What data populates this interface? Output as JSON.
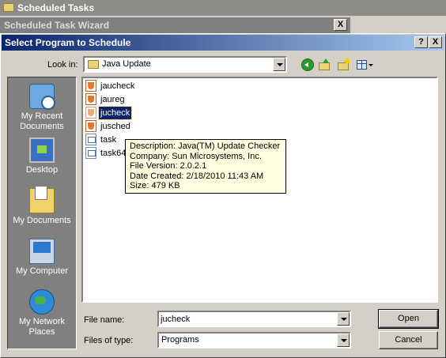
{
  "background_window": {
    "title": "Scheduled Tasks"
  },
  "wizard_window": {
    "title": "Scheduled Task Wizard",
    "close_label": "X"
  },
  "dialog": {
    "title": "Select Program to Schedule",
    "help_label": "?",
    "close_label": "X"
  },
  "lookin": {
    "label": "Look in:",
    "value": "Java Update"
  },
  "toolbar": {
    "back_icon": "back-arrow-icon",
    "up_icon": "up-one-level-icon",
    "newfolder_icon": "new-folder-icon",
    "views_icon": "views-menu-icon"
  },
  "places": [
    {
      "label": "My Recent Documents",
      "line1": "My Recent",
      "line2": "Documents",
      "icon": "recent-documents-icon"
    },
    {
      "label": "Desktop",
      "line1": "Desktop",
      "line2": "",
      "icon": "desktop-icon"
    },
    {
      "label": "My Documents",
      "line1": "My Documents",
      "line2": "",
      "icon": "my-documents-icon"
    },
    {
      "label": "My Computer",
      "line1": "My Computer",
      "line2": "",
      "icon": "my-computer-icon"
    },
    {
      "label": "My Network Places",
      "line1": "My Network",
      "line2": "Places",
      "icon": "network-places-icon"
    }
  ],
  "files": [
    {
      "name": "jaucheck",
      "icon": "java-icon",
      "selected": false
    },
    {
      "name": "jaureg",
      "icon": "java-icon",
      "selected": false
    },
    {
      "name": "jucheck",
      "icon": "java-icon",
      "selected": true
    },
    {
      "name": "jusched",
      "icon": "java-icon",
      "selected": false
    },
    {
      "name": "task",
      "icon": "program-icon",
      "selected": false
    },
    {
      "name": "task64",
      "icon": "program-icon",
      "selected": false
    }
  ],
  "tooltip": {
    "description": "Description: Java(TM) Update Checker",
    "company": "Company: Sun Microsystems, Inc.",
    "version": "File Version: 2.0.2.1",
    "created": "Date Created: 2/18/2010 11:43 AM",
    "size": "Size: 479 KB"
  },
  "filename": {
    "label": "File name:",
    "value": "jucheck"
  },
  "filetype": {
    "label": "Files of type:",
    "value": "Programs"
  },
  "buttons": {
    "open": "Open",
    "cancel": "Cancel"
  },
  "colors": {
    "title_active_start": "#0a246a",
    "title_active_end": "#a6caf0",
    "selection": "#0a246a",
    "tooltip_bg": "#ffffe1",
    "face": "#d4d0c8"
  }
}
